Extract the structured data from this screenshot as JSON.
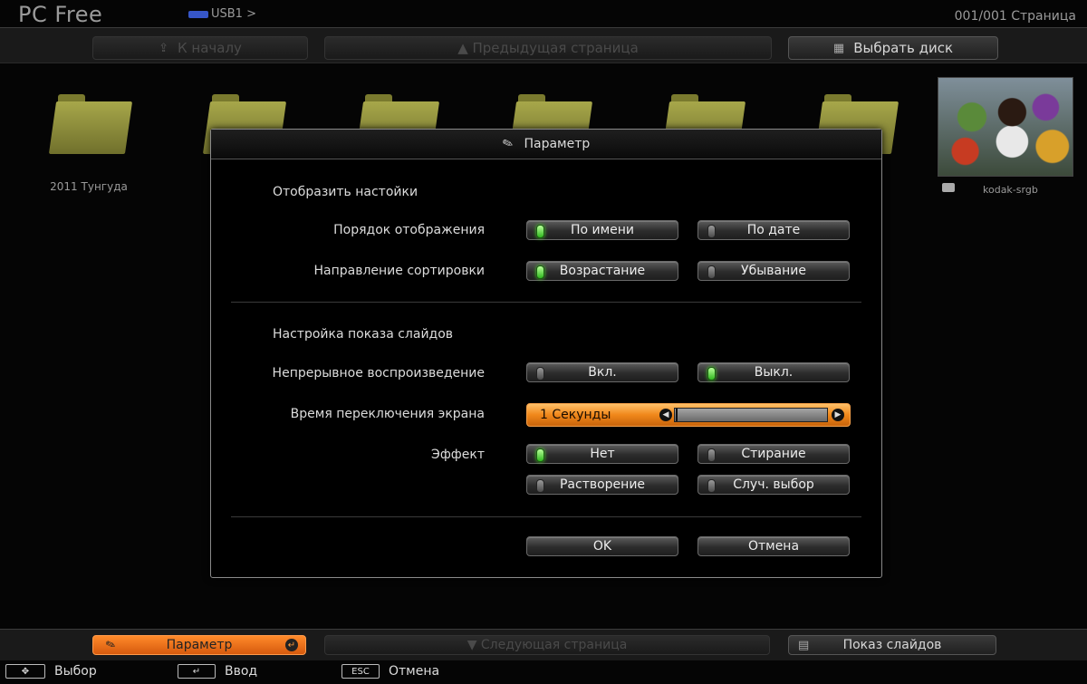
{
  "header": {
    "app_title": "PC Free",
    "source_label": "USB1 >",
    "page_counter": "001/001 Страница"
  },
  "top_nav": {
    "home_label": "К началу",
    "prev_page_label": "▲ Предыдущая страница",
    "select_disk_label": "Выбрать диск"
  },
  "files": {
    "folder_name": "2011 Тунгуда",
    "thumbnail_name": "kodak-srgb"
  },
  "dialog": {
    "title": "Параметр",
    "display_section": {
      "title": "Отобразить настойки",
      "order_label": "Порядок отображения",
      "order_options": [
        {
          "label": "По имени",
          "selected": true
        },
        {
          "label": "По дате",
          "selected": false
        }
      ],
      "sort_label": "Направление сортировки",
      "sort_options": [
        {
          "label": "Возрастание",
          "selected": true
        },
        {
          "label": "Убывание",
          "selected": false
        }
      ]
    },
    "slideshow_section": {
      "title": "Настройка показа слайдов",
      "continuous_label": "Непрерывное воспроизведение",
      "continuous_options": [
        {
          "label": "Вкл.",
          "selected": false
        },
        {
          "label": "Выкл.",
          "selected": true
        }
      ],
      "switch_time_label": "Время переключения экрана",
      "switch_time_value": "1 Секунды",
      "switch_time_level": 0,
      "effect_label": "Эффект",
      "effect_options": [
        {
          "label": "Нет",
          "selected": true
        },
        {
          "label": "Стирание",
          "selected": false
        },
        {
          "label": "Растворение",
          "selected": false
        },
        {
          "label": "Случ. выбор",
          "selected": false
        }
      ]
    },
    "ok_label": "OK",
    "cancel_label": "Отмена"
  },
  "bottom_nav": {
    "param_label": "Параметр",
    "next_page_label": "▼ Следующая страница",
    "slideshow_label": "Показ слайдов"
  },
  "hints": {
    "select_label": "Выбор",
    "enter_label": "Ввод",
    "esc_key": "ESC",
    "cancel_label": "Отмена"
  },
  "colors": {
    "accent_orange": "#f0871a",
    "led_green": "#2fb81e",
    "folder_yellow": "#a7a74a"
  }
}
